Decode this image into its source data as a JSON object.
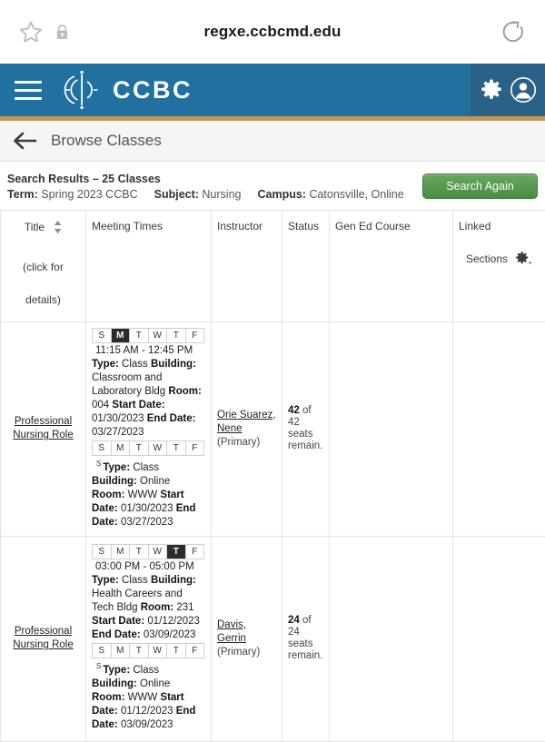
{
  "browser": {
    "url": "regxe.ccbcmd.edu",
    "bookmark_icon": "star-icon",
    "lock_icon": "lock-icon",
    "reload_icon": "reload-icon"
  },
  "navbar": {
    "menu_icon": "hamburger-menu-icon",
    "brand": "CCBC",
    "logo_icon": "ccbc-logo-icon",
    "settings_icon": "gear-icon",
    "account_icon": "user-avatar-icon",
    "bg_color": "#22709f",
    "accent_color": "#c29654"
  },
  "page_bar": {
    "back_icon": "back-arrow-icon",
    "title": "Browse Classes"
  },
  "summary": {
    "results_label": "Search Results",
    "results_dash": " – ",
    "results_count": "25 Classes",
    "term_label": "Term:",
    "term_value": "Spring 2023 CCBC",
    "subject_label": "Subject:",
    "subject_value": "Nursing",
    "campus_label": "Campus:",
    "campus_value": "Catonsville, Online",
    "search_again_label": "Search Again",
    "search_again_color": "#4f9147"
  },
  "table": {
    "headers": {
      "title": "Title",
      "title_sub1": "(click for",
      "title_sub2": "details)",
      "meeting_times": "Meeting Times",
      "instructor": "Instructor",
      "status": "Status",
      "gen_ed": "Gen Ed Course",
      "linked1": "Linked",
      "linked2": "Sections",
      "sort_icon": "sort-updown-icon",
      "settings_icon": "gear-dropdown-icon"
    },
    "rows": [
      {
        "title": "Professional Nursing Role",
        "instructor_name": "Orie Suarez, Nene",
        "instructor_role": "(Primary)",
        "status_seats": "42",
        "status_text_of": " of ",
        "status_total": "42",
        "status_suffix": " seats remain.",
        "gen_ed": "",
        "linked": "",
        "meetings": [
          {
            "days": [
              "S",
              "M",
              "T",
              "W",
              "T",
              "F"
            ],
            "active": [
              1
            ],
            "time": "11:15 AM - 12:45 PM",
            "type_label": "Type:",
            "type_value": "Class",
            "building_label": "Building:",
            "building_value": "Classroom and Laboratory Bldg",
            "room_label": "Room:",
            "room_value": "004",
            "start_label": "Start Date:",
            "start_value": "01/30/2023",
            "end_label": "End Date:",
            "end_value": "03/27/2023"
          },
          {
            "days": [
              "S",
              "M",
              "T",
              "W",
              "T",
              "F"
            ],
            "active": [],
            "time": "S",
            "type_label": "Type:",
            "type_value": "Class",
            "building_label": "Building:",
            "building_value": "Online",
            "room_label": "Room:",
            "room_value": "WWW",
            "start_label": "Start Date:",
            "start_value": "01/30/2023",
            "end_label": "End Date:",
            "end_value": "03/27/2023"
          }
        ]
      },
      {
        "title": "Professional Nursing Role",
        "instructor_name": "Davis, Gerrin",
        "instructor_role": "(Primary)",
        "status_seats": "24",
        "status_text_of": " of ",
        "status_total": "24",
        "status_suffix": " seats remain.",
        "gen_ed": "",
        "linked": "",
        "meetings": [
          {
            "days": [
              "S",
              "M",
              "T",
              "W",
              "T",
              "F"
            ],
            "active": [
              4
            ],
            "time": "03:00 PM - 05:00 PM",
            "type_label": "Type:",
            "type_value": "Class",
            "building_label": "Building:",
            "building_value": "Health Careers and Tech Bldg",
            "room_label": "Room:",
            "room_value": "231",
            "start_label": "Start Date:",
            "start_value": "01/12/2023",
            "end_label": "End Date:",
            "end_value": "03/09/2023"
          },
          {
            "days": [
              "S",
              "M",
              "T",
              "W",
              "T",
              "F"
            ],
            "active": [],
            "time": "S",
            "type_label": "Type:",
            "type_value": "Class",
            "building_label": "Building:",
            "building_value": "Online",
            "room_label": "Room:",
            "room_value": "WWW",
            "start_label": "Start Date:",
            "start_value": "01/12/2023",
            "end_label": "End Date:",
            "end_value": "03/09/2023"
          }
        ]
      }
    ]
  }
}
